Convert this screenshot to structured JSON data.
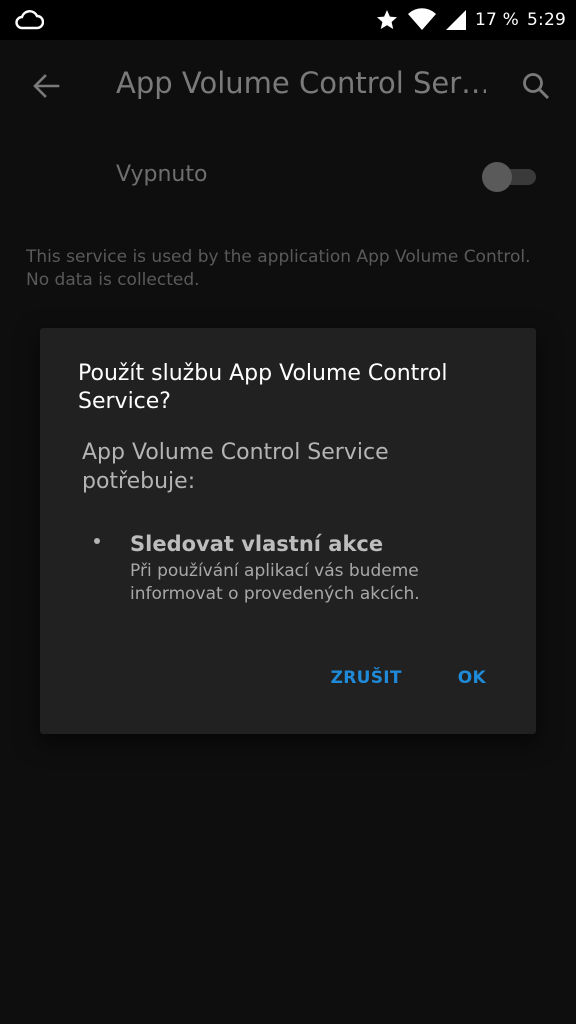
{
  "status_bar": {
    "battery_percent": "17 %",
    "time": "5:29",
    "icons": [
      "cloud-icon",
      "star-icon",
      "wifi-icon",
      "signal-icon"
    ]
  },
  "app_bar": {
    "title": "App Volume Control Ser…",
    "icons": [
      "back-arrow-icon",
      "search-icon"
    ]
  },
  "toggle": {
    "label": "Vypnuto",
    "state": "off"
  },
  "description": "This service is used by the application App Volume Control. No data is collected.",
  "dialog": {
    "title": "Použít službu App Volume Control Service?",
    "message": "App Volume Control Service potřebuje:",
    "permission": {
      "title": "Sledovat vlastní akce",
      "description": "Při používání aplikací vás budeme informovat o provedených akcích."
    },
    "actions": {
      "cancel": "ZRUŠIT",
      "ok": "OK"
    }
  },
  "colors": {
    "accent": "#1f8ad8",
    "dialog_bg": "#212121",
    "screen_bg": "#0e0e0e"
  }
}
